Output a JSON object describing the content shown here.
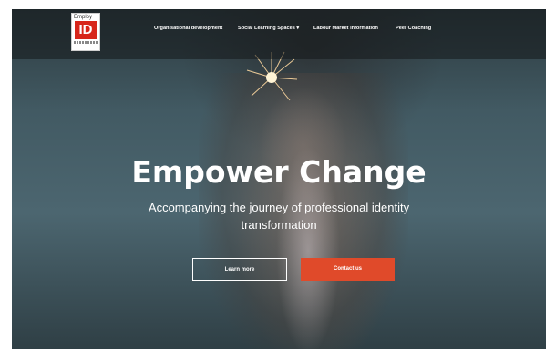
{
  "logo": {
    "top_text": "Employ",
    "mark": "ID",
    "icon": "employ-id-logo"
  },
  "nav": {
    "items": [
      {
        "label": "Organisational development"
      },
      {
        "label": "Social Learning Spaces"
      },
      {
        "label": "Labour Market Information"
      },
      {
        "label": "Peer Coaching"
      }
    ],
    "dropdown_caret": "▾"
  },
  "hero": {
    "title": "Empower Change",
    "subtitle_line1": "Accompanying the journey of professional identity",
    "subtitle_line2": "transformation",
    "primary_button": "Learn more",
    "secondary_button": "Contact us"
  },
  "colors": {
    "accent": "#e04a2a",
    "logo_red": "#d7261b"
  }
}
